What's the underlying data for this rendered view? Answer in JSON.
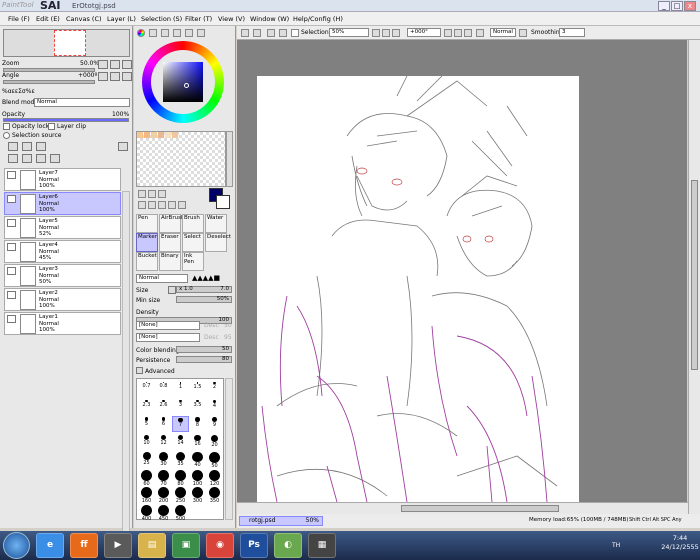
{
  "title_bar": {
    "logo_small": "PaintTool",
    "logo_big": "SAI",
    "document": "ErOtotgj.psd",
    "btn_min": "_",
    "btn_max": "□",
    "btn_close": "x"
  },
  "menu": [
    "File (F)",
    "Edit (E)",
    "Canvas (C)",
    "Layer (L)",
    "Selection (S)",
    "Filter (T)",
    "View (V)",
    "Window (W)",
    "Help/Config (H)"
  ],
  "navigator": {
    "zoom_label": "Zoom",
    "zoom_value": "50.0%",
    "angle_label": "Angle",
    "angle_value": "+000º"
  },
  "layer_panel": {
    "effect_label": "%αεεΣσ%ε",
    "blend_mode_label": "Blend mode",
    "blend_mode_value": "Normal",
    "opacity_label": "Opacity",
    "opacity_value": "100%",
    "opacity_lock": "Opacity lock",
    "layer_clip": "Layer clip",
    "selection_source": "Selection source",
    "layers": [
      {
        "name": "Layer7",
        "mode": "Normal",
        "opacity": "100%"
      },
      {
        "name": "Layer6",
        "mode": "Normal",
        "opacity": "100%"
      },
      {
        "name": "Layer5",
        "mode": "Normal",
        "opacity": "52%"
      },
      {
        "name": "Layer4",
        "mode": "Normal",
        "opacity": "45%"
      },
      {
        "name": "Layer3",
        "mode": "Normal",
        "opacity": "50%"
      },
      {
        "name": "Layer2",
        "mode": "Normal",
        "opacity": "100%"
      },
      {
        "name": "Layer1",
        "mode": "Normal",
        "opacity": "100%"
      }
    ]
  },
  "colors": {
    "primary": "#000066",
    "secondary": "#ffffff",
    "accent": "#c8c8ff",
    "swatches": [
      "#f8c890",
      "#f4b880",
      "#f0d0a0",
      "#e8b890",
      "#f8e0c0",
      "#f0c8a0"
    ]
  },
  "tools": {
    "labels": [
      "Pen",
      "AirBrush",
      "Brush",
      "Water",
      "Marker",
      "Eraser",
      "Select",
      "Deselect",
      "Bucket",
      "Binary",
      "Ink Pen"
    ],
    "selected": "Marker"
  },
  "brush": {
    "mode": "Normal",
    "size_label": "Size",
    "size_mult": "x 1.0",
    "size_value": "7.0",
    "min_size_label": "Min size",
    "min_size_value": "50%",
    "density_label": "Density",
    "density_value": "100",
    "texture1": "[None]",
    "texture1_val": "50",
    "texture1_label": "Desc",
    "texture2": "[None]",
    "texture2_val": "95",
    "texture2_label": "Desc",
    "blending_label": "Color blending",
    "blending_value": "50",
    "persistence_label": "Persistence",
    "persistence_value": "80",
    "advanced_label": "Advanced",
    "sizes": [
      "0.7",
      "0.8",
      "1",
      "1.5",
      "2",
      "2.3",
      "2.6",
      "3",
      "3.5",
      "4",
      "5",
      "6",
      "7",
      "8",
      "9",
      "10",
      "12",
      "14",
      "16",
      "20",
      "25",
      "30",
      "35",
      "40",
      "50",
      "60",
      "70",
      "80",
      "100",
      "120",
      "160",
      "200",
      "250",
      "300",
      "350",
      "400",
      "450",
      "500"
    ],
    "selected_size": "7"
  },
  "toolbar": {
    "selection_label": "Selection",
    "zoom": "50%",
    "angle": "+000°",
    "mode": "Normal",
    "smoothing_label": "Smoothing",
    "smoothing_value": "3"
  },
  "status": {
    "doc_tab": "rotgj.psd",
    "doc_zoom": "50%",
    "memory": "Memory load:65% (100MB / 748MB)",
    "keys": "Shift Ctrl Alt SPC Any"
  },
  "taskbar": {
    "apps": [
      "e",
      "ff",
      "▶",
      "▤",
      "▣",
      "◉",
      "Ps",
      "◐",
      "▦"
    ],
    "lang": "TH",
    "time": "7:44",
    "date": "24/12/2555"
  }
}
